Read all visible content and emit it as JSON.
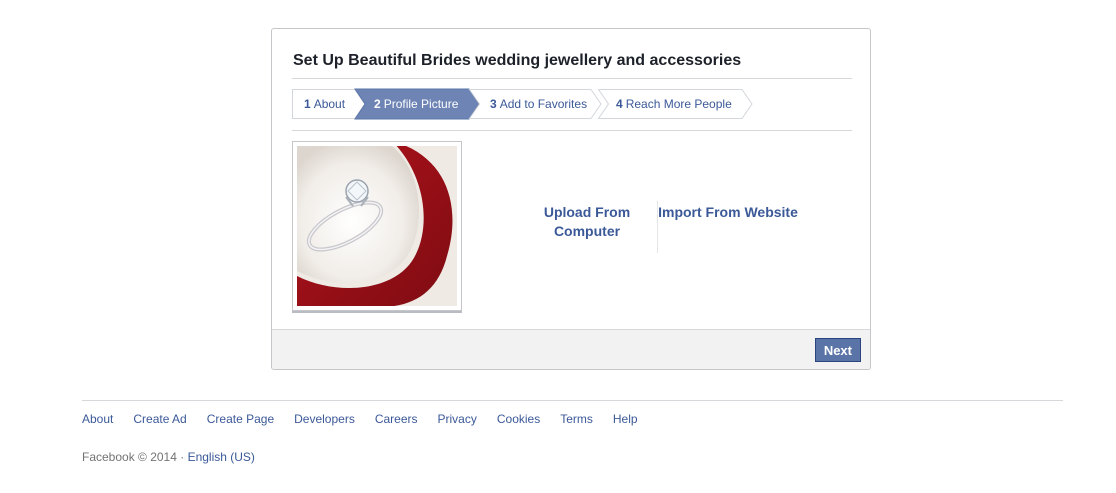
{
  "dialog": {
    "title": "Set Up Beautiful Brides wedding jewellery and accessories",
    "steps": [
      {
        "num": "1",
        "label": "About",
        "active": false
      },
      {
        "num": "2",
        "label": "Profile Picture",
        "active": true
      },
      {
        "num": "3",
        "label": "Add to Favorites",
        "active": false
      },
      {
        "num": "4",
        "label": "Reach More People",
        "active": false
      }
    ],
    "upload_from_computer": "Upload From Computer",
    "import_from_website": "Import From Website",
    "next_label": "Next",
    "photo_icon": "ring-photo"
  },
  "footer": {
    "links": [
      "About",
      "Create Ad",
      "Create Page",
      "Developers",
      "Careers",
      "Privacy",
      "Cookies",
      "Terms",
      "Help"
    ],
    "copyright": "Facebook © 2014 · ",
    "language": "English (US)"
  },
  "colors": {
    "accent": "#3b5998",
    "active_step": "#6d84b4",
    "next_button": "#5b74a8"
  }
}
